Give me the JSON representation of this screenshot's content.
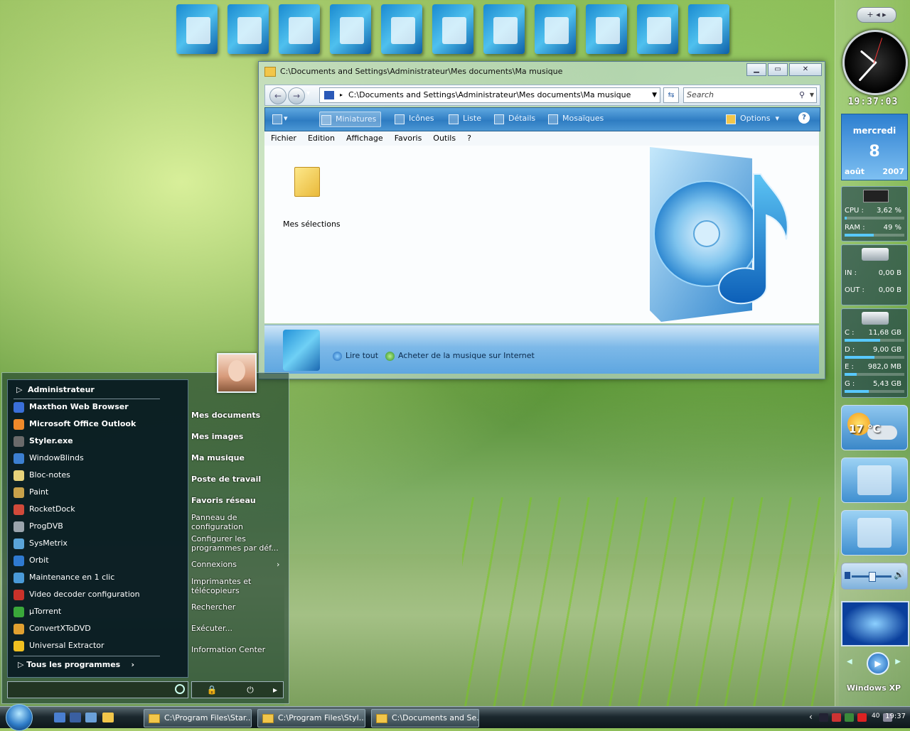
{
  "explorer": {
    "title": "C:\\Documents and Settings\\Administrateur\\Mes documents\\Ma musique",
    "address": "C:\\Documents and Settings\\Administrateur\\Mes documents\\Ma musique",
    "search_placeholder": "Search",
    "toolbar": {
      "miniatures": "Miniatures",
      "icones": "Icônes",
      "liste": "Liste",
      "details": "Détails",
      "mosaiques": "Mosaïques",
      "options": "Options",
      "help": "?"
    },
    "menu": [
      "Fichier",
      "Edition",
      "Affichage",
      "Favoris",
      "Outils",
      "?"
    ],
    "folder_label": "Mes sélections",
    "tasks": {
      "play_all": "Lire tout",
      "buy_music": "Acheter de la musique sur Internet"
    }
  },
  "start_menu": {
    "user": "Administrateur",
    "pinned": [
      {
        "label": "Maxthon Web Browser",
        "color": "#3a6fd8"
      },
      {
        "label": "Microsoft Office Outlook",
        "color": "#f08a2a"
      }
    ],
    "recent": [
      {
        "label": "Styler.exe",
        "color": "#6a6a6a"
      },
      {
        "label": "WindowBlinds",
        "color": "#3c7fd0"
      },
      {
        "label": "Bloc-notes",
        "color": "#e6d27a"
      },
      {
        "label": "Paint",
        "color": "#c8a24a"
      },
      {
        "label": "RocketDock",
        "color": "#d04a3a"
      },
      {
        "label": "ProgDVB",
        "color": "#9aa4ac"
      },
      {
        "label": "SysMetrix",
        "color": "#5aa4d8"
      },
      {
        "label": "Orbit",
        "color": "#2f7ad0"
      },
      {
        "label": "Maintenance en 1 clic",
        "color": "#4a9ad8"
      },
      {
        "label": "Video decoder configuration",
        "color": "#c8322a"
      },
      {
        "label": "µTorrent",
        "color": "#3aa83a"
      },
      {
        "label": "ConvertXToDVD",
        "color": "#e0a030"
      },
      {
        "label": "Universal Extractor",
        "color": "#f0c020"
      }
    ],
    "all_programs": "Tous les programmes",
    "right": [
      "Mes documents",
      "Mes images",
      "Ma musique",
      "Poste de travail",
      "Favoris réseau",
      "Panneau de configuration",
      "Configurer les programmes par déf...",
      "Connexions",
      "Imprimantes et télécopieurs",
      "Rechercher",
      "Exécuter...",
      "Information Center"
    ]
  },
  "sidebar": {
    "top_control": "+ ◂ ▸",
    "digital_time": "19:37:03",
    "calendar": {
      "day": "mercredi",
      "date": "8",
      "month": "août",
      "year": "2007"
    },
    "cpu": {
      "label": "CPU :",
      "value": "3,62 %",
      "fill": 0.04
    },
    "ram": {
      "label": "RAM :",
      "value": "49 %",
      "fill": 0.49
    },
    "net_in": {
      "label": "IN :",
      "value": "0,00 B"
    },
    "net_out": {
      "label": "OUT :",
      "value": "0,00 B"
    },
    "drives": [
      {
        "label": "C :",
        "value": "11,68 GB",
        "fill": 0.6
      },
      {
        "label": "D :",
        "value": "9,00 GB",
        "fill": 0.5
      },
      {
        "label": "E :",
        "value": "982,0 MB",
        "fill": 0.2
      },
      {
        "label": "G :",
        "value": "5,43 GB",
        "fill": 0.4
      }
    ],
    "weather_temp": "17 °C",
    "brand": "Windows XP"
  },
  "taskbar": {
    "items": [
      "C:\\Program Files\\Star...",
      "C:\\Program Files\\Styl...",
      "C:\\Documents and Se..."
    ],
    "clock": "19:37",
    "volume": "40"
  }
}
